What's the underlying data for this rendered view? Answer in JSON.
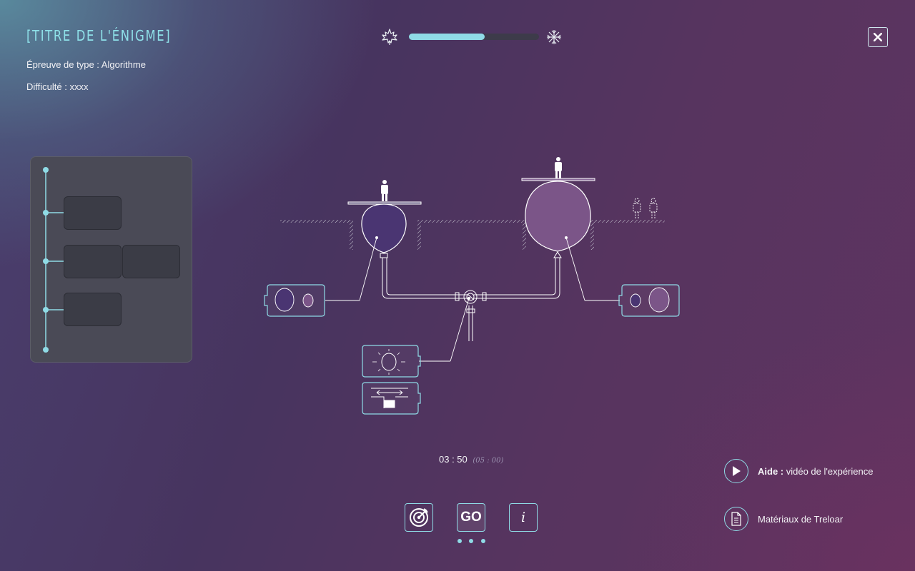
{
  "header": {
    "title": "[TITRE DE L'ÉNIGME]",
    "type_line": "Épreuve de type : Algorithme",
    "difficulty_line": "Difficulté : xxxx"
  },
  "progress": {
    "value": 0.58,
    "left_icon": "maple-leaf-icon",
    "right_icon": "snowflake-icon"
  },
  "close": {
    "icon": "close-icon"
  },
  "timer": {
    "elapsed": "03 : 50",
    "limit": "(05 : 00)"
  },
  "toolbar": {
    "target_icon": "target-icon",
    "go_label": "GO",
    "info_label": "i",
    "page_dots": 3
  },
  "help": {
    "video_bold": "Aide :",
    "video_text": " vidéo de l'expérience",
    "materials_text": "Matériaux de Treloar"
  },
  "colors": {
    "accent": "#8fdbe6",
    "balloon_left": "#4a3572",
    "balloon_right": "#7b5588",
    "panel": "#4a4a56"
  }
}
